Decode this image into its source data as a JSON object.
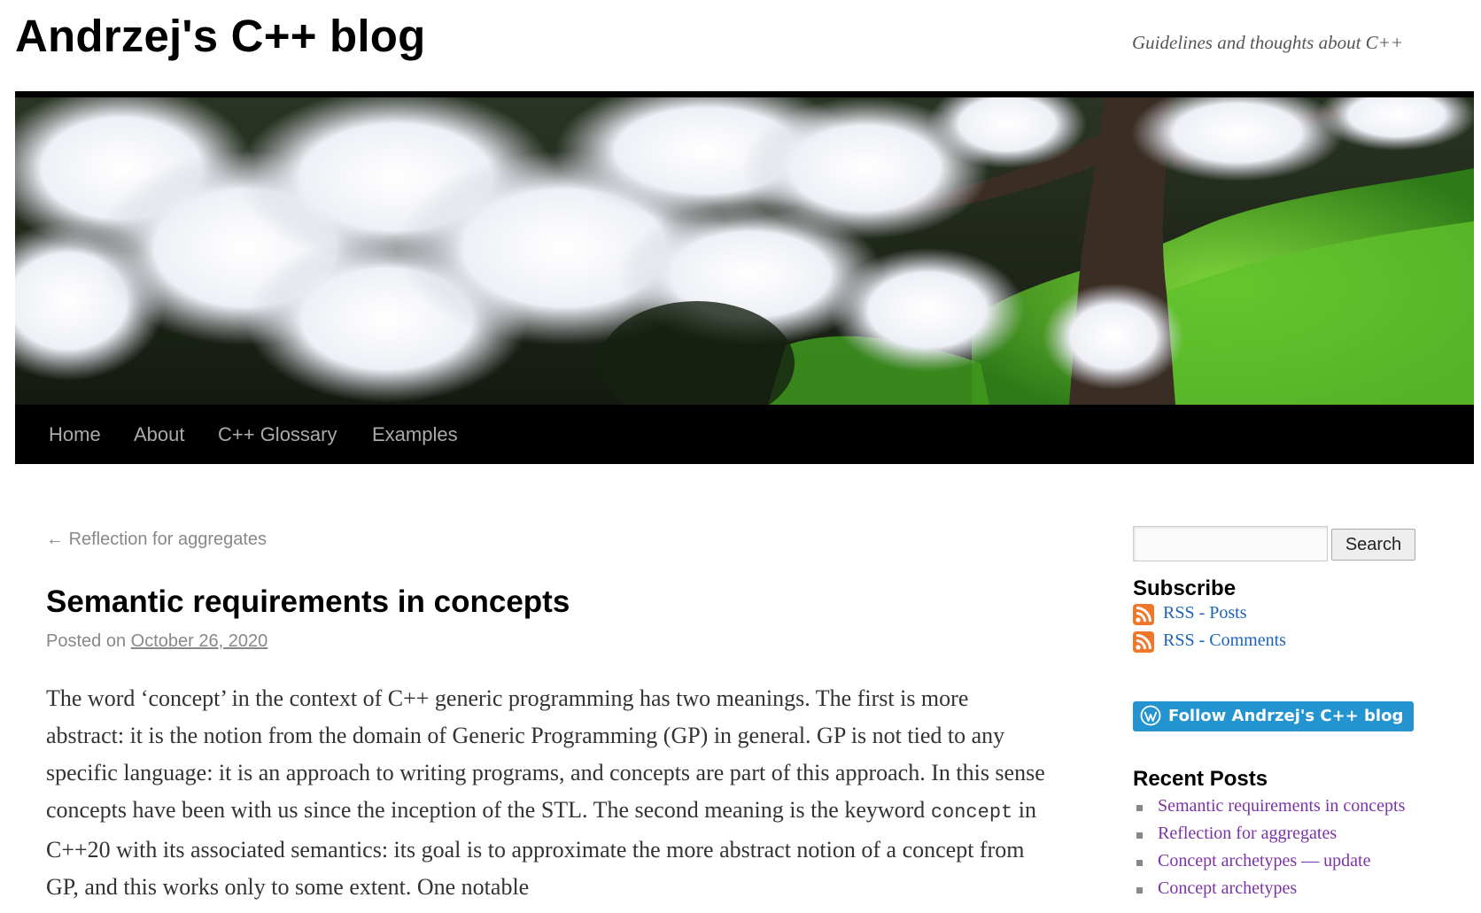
{
  "site": {
    "title": "Andrzej's C++ blog",
    "description": "Guidelines and thoughts about C++"
  },
  "nav": {
    "items": [
      {
        "label": "Home"
      },
      {
        "label": "About"
      },
      {
        "label": "C++ Glossary"
      },
      {
        "label": "Examples"
      }
    ]
  },
  "post": {
    "prev_arrow": "←",
    "prev_label": "Reflection for aggregates",
    "title": "Semantic requirements in concepts",
    "posted_on": "Posted on",
    "date": "October 26, 2020",
    "body": {
      "part1": "The word ‘concept’ in the context of C++ generic programming has two meanings. The first is more abstract: it is the notion from the domain of Generic Programming (GP) in general. GP is not tied to any specific language: it is an approach to writing programs, and concepts are part of this approach. In this sense concepts have been with us since the inception of the STL. The second meaning is the keyword ",
      "code": "concept",
      "part2": " in C++20 with its associated semantics: its goal is to approximate the more abstract notion of a concept from GP, and this works only to some extent. One notable"
    }
  },
  "sidebar": {
    "search": {
      "placeholder": "",
      "button_label": "Search"
    },
    "subscribe": {
      "title": "Subscribe",
      "links": [
        {
          "label": "RSS - Posts",
          "icon": "rss-icon"
        },
        {
          "label": "RSS - Comments",
          "icon": "rss-icon"
        }
      ]
    },
    "follow_label": "Follow Andrzej's C++ blog",
    "recent": {
      "title": "Recent Posts",
      "items": [
        {
          "label": "Semantic requirements in concepts"
        },
        {
          "label": "Reflection for aggregates"
        },
        {
          "label": "Concept archetypes — update"
        },
        {
          "label": "Concept archetypes"
        }
      ]
    }
  },
  "colors": {
    "nav_background": "#000000",
    "nav_text": "#aaaaaa",
    "link_blue": "#1b63b8",
    "link_visited": "#7b33a6",
    "follow_button": "#2494d0",
    "rss_orange": "#f0772a"
  }
}
